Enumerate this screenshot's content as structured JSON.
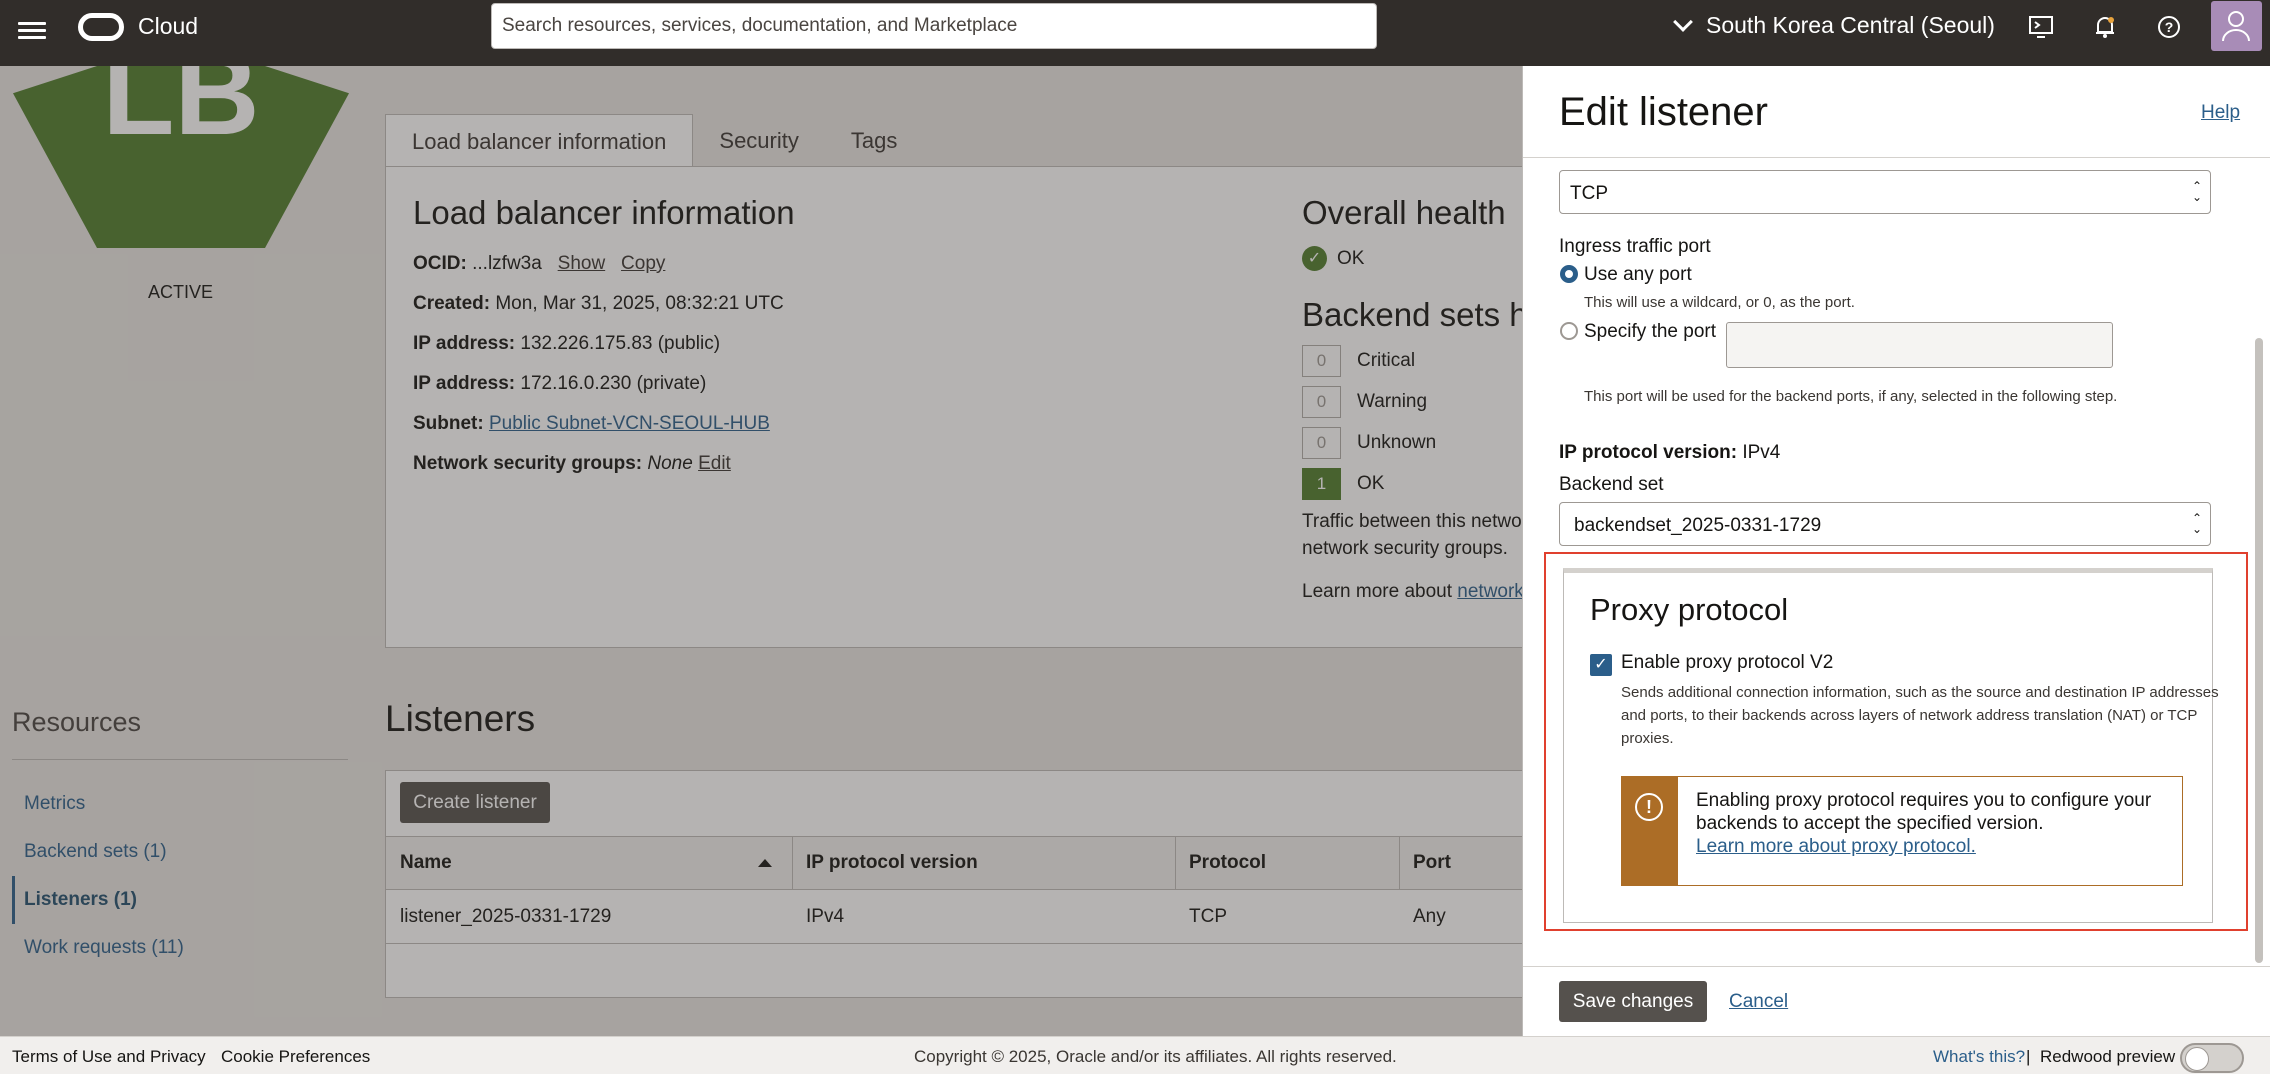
{
  "topbar": {
    "brand": "Cloud",
    "search_placeholder": "Search resources, services, documentation, and Marketplace",
    "region": "South Korea Central (Seoul)"
  },
  "lb": {
    "badge": "LB",
    "status": "ACTIVE",
    "tabs": [
      "Load balancer information",
      "Security",
      "Tags"
    ],
    "info_title": "Load balancer information",
    "ocid_label": "OCID:",
    "ocid_value": "...lzfw3a",
    "show": "Show",
    "copy": "Copy",
    "created_label": "Created:",
    "created_value": "Mon, Mar 31, 2025, 08:32:21 UTC",
    "ip_label": "IP address:",
    "ip_public": "132.226.175.83 (public)",
    "ip_private": "172.16.0.230 (private)",
    "subnet_label": "Subnet:",
    "subnet_value": "Public Subnet-VCN-SEOUL-HUB",
    "nsg_label": "Network security groups:",
    "nsg_value": "None",
    "nsg_edit": "Edit",
    "health_title": "Overall health",
    "health_value": "OK",
    "backend_health_title": "Backend sets h",
    "health_rows": [
      {
        "count": "0",
        "label": "Critical"
      },
      {
        "count": "0",
        "label": "Warning"
      },
      {
        "count": "0",
        "label": "Unknown"
      },
      {
        "count": "1",
        "label": "OK"
      }
    ],
    "traffic_text_1": "Traffic between this netwo",
    "traffic_text_2": "network security groups.",
    "learn_text": "Learn more about",
    "learn_link": "network"
  },
  "resources": {
    "title": "Resources",
    "items": [
      "Metrics",
      "Backend sets (1)",
      "Listeners (1)",
      "Work requests (11)"
    ]
  },
  "listeners": {
    "title": "Listeners",
    "create_button": "Create listener",
    "columns": [
      "Name",
      "IP protocol version",
      "Protocol",
      "Port"
    ],
    "rows": [
      [
        "listener_2025-0331-1729",
        "IPv4",
        "TCP",
        "Any"
      ]
    ]
  },
  "footer": {
    "terms": "Terms of Use and Privacy",
    "cookies": "Cookie Preferences",
    "copyright": "Copyright © 2025, Oracle and/or its affiliates. All rights reserved.",
    "whats_this": "What's this?",
    "separator": "|",
    "redwood": "Redwood preview"
  },
  "panel": {
    "title": "Edit listener",
    "help": "Help",
    "protocol_value": "TCP",
    "ingress_label": "Ingress traffic port",
    "use_any_port": "Use any port",
    "use_any_hint": "This will use a wildcard, or 0, as the port.",
    "specify_port": "Specify the port",
    "port_hint": "This port will be used for the backend ports, if any, selected in the following step.",
    "ip_version_label": "IP protocol version:",
    "ip_version_value": "IPv4",
    "backend_set_label": "Backend set",
    "backend_set_value": "backendset_2025-0331-1729",
    "proxy_title": "Proxy protocol",
    "proxy_checkbox": "Enable proxy protocol V2",
    "proxy_desc_1": "Sends additional connection information, such as the source and destination IP addresses",
    "proxy_desc_2": "and ports, to their backends across layers of network address translation (NAT) or TCP",
    "proxy_desc_3": "proxies.",
    "warning_text": "Enabling proxy protocol requires you to configure your backends to accept the specified version.",
    "warning_link": "Learn more about proxy protocol.",
    "save": "Save changes",
    "cancel": "Cancel"
  }
}
